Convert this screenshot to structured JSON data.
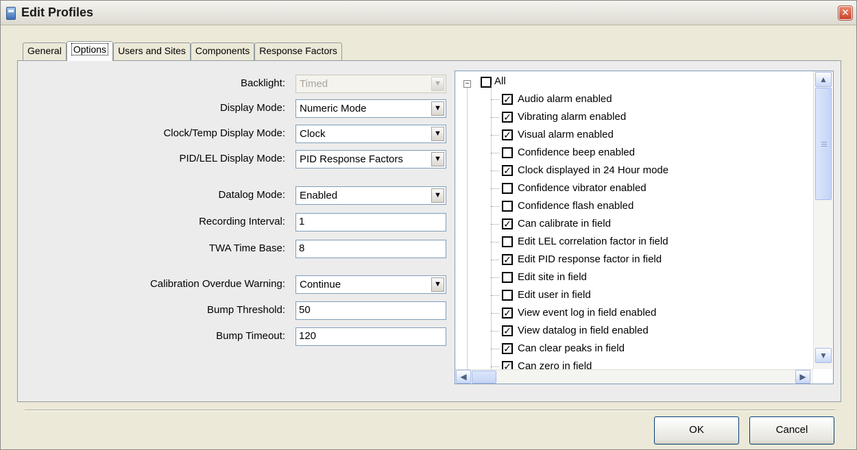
{
  "window": {
    "title": "Edit Profiles",
    "close_glyph": "✕"
  },
  "tabs": [
    {
      "label": "General"
    },
    {
      "label": "Options"
    },
    {
      "label": "Users and Sites"
    },
    {
      "label": "Components"
    },
    {
      "label": "Response Factors"
    }
  ],
  "active_tab": "Options",
  "fields": {
    "backlight": {
      "label": "Backlight:",
      "value": "Timed",
      "disabled": true
    },
    "display_mode": {
      "label": "Display Mode:",
      "value": "Numeric Mode"
    },
    "clock_temp_mode": {
      "label": "Clock/Temp Display Mode:",
      "value": "Clock"
    },
    "pid_lel_mode": {
      "label": "PID/LEL Display Mode:",
      "value": "PID Response Factors"
    },
    "datalog_mode": {
      "label": "Datalog Mode:",
      "value": "Enabled"
    },
    "recording_interval": {
      "label": "Recording Interval:",
      "value": "1"
    },
    "twa_time_base": {
      "label": "TWA Time Base:",
      "value": "8"
    },
    "calibration_overdue": {
      "label": "Calibration Overdue Warning:",
      "value": "Continue"
    },
    "bump_threshold": {
      "label": "Bump Threshold:",
      "value": "50"
    },
    "bump_timeout": {
      "label": "Bump Timeout:",
      "value": "120"
    }
  },
  "tree": {
    "root": {
      "label": "All",
      "checked": false,
      "expander": "−"
    },
    "items": [
      {
        "label": "Audio alarm enabled",
        "checked": true
      },
      {
        "label": "Vibrating alarm enabled",
        "checked": true
      },
      {
        "label": "Visual alarm enabled",
        "checked": true
      },
      {
        "label": "Confidence beep enabled",
        "checked": false
      },
      {
        "label": "Clock displayed in 24 Hour mode",
        "checked": true
      },
      {
        "label": "Confidence vibrator enabled",
        "checked": false
      },
      {
        "label": "Confidence flash enabled",
        "checked": false
      },
      {
        "label": "Can calibrate in field",
        "checked": true
      },
      {
        "label": "Edit LEL correlation factor in field",
        "checked": false
      },
      {
        "label": "Edit PID response factor in field",
        "checked": true
      },
      {
        "label": "Edit site in field",
        "checked": false
      },
      {
        "label": "Edit user in field",
        "checked": false
      },
      {
        "label": "View event log in field enabled",
        "checked": true
      },
      {
        "label": "View datalog in field enabled",
        "checked": true
      },
      {
        "label": "Can clear peaks in field",
        "checked": true
      },
      {
        "label": "Can zero in field",
        "checked": true
      }
    ],
    "check_glyph": "✓"
  },
  "buttons": {
    "ok": "OK",
    "cancel": "Cancel"
  },
  "icons": {
    "scroll_up": "▲",
    "scroll_down": "▼",
    "scroll_left": "◀",
    "scroll_right": "▶",
    "dropdown": "▼"
  }
}
